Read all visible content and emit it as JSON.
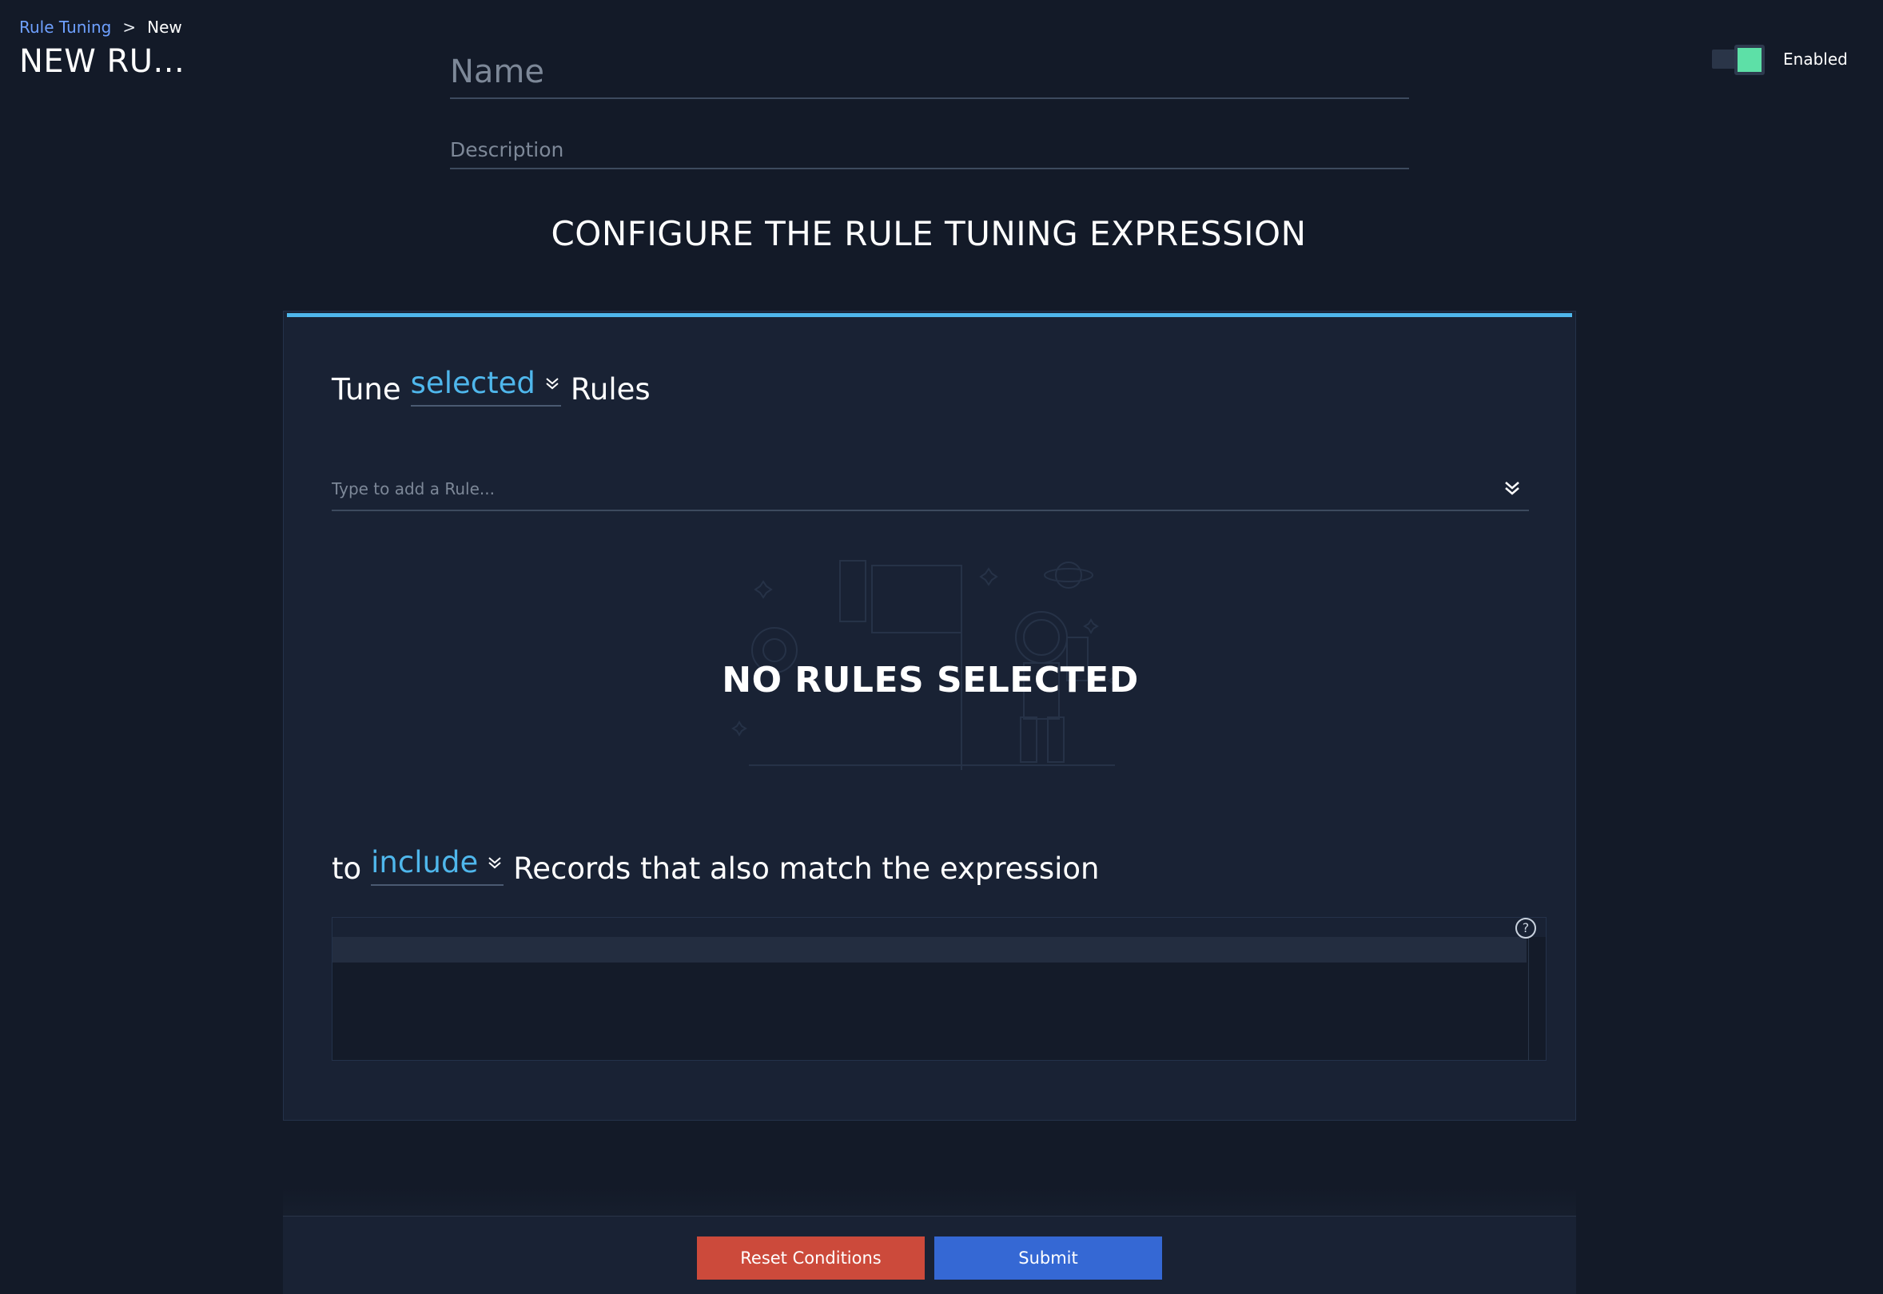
{
  "breadcrumb": {
    "parent": "Rule Tuning",
    "separator": ">",
    "current": "New"
  },
  "page_title": "NEW RU...",
  "toggle": {
    "label": "Enabled",
    "state": true,
    "accent_color": "#5de0a7"
  },
  "form": {
    "name_placeholder": "Name",
    "name_value": "",
    "description_placeholder": "Description",
    "description_value": ""
  },
  "section_title": "CONFIGURE THE RULE TUNING EXPRESSION",
  "tune_row": {
    "prefix": "Tune",
    "selector_value": "selected",
    "suffix": "Rules"
  },
  "rule_input": {
    "placeholder": "Type to add a Rule..."
  },
  "empty_state": {
    "text": "NO RULES SELECTED",
    "illustration": "astronaut-space-illustration"
  },
  "to_row": {
    "prefix": "to",
    "selector_value": "include",
    "suffix": "Records that also match the expression"
  },
  "expression_editor": {
    "help_glyph": "?",
    "value": ""
  },
  "buttons": {
    "reset_label": "Reset Conditions",
    "submit_label": "Submit"
  },
  "colors": {
    "background": "#131a28",
    "panel": "#192234",
    "accent_blue": "#4fb7ec",
    "link_blue": "#6ea0ff",
    "reset_red": "#cc4a3b",
    "submit_blue": "#3568d4"
  }
}
